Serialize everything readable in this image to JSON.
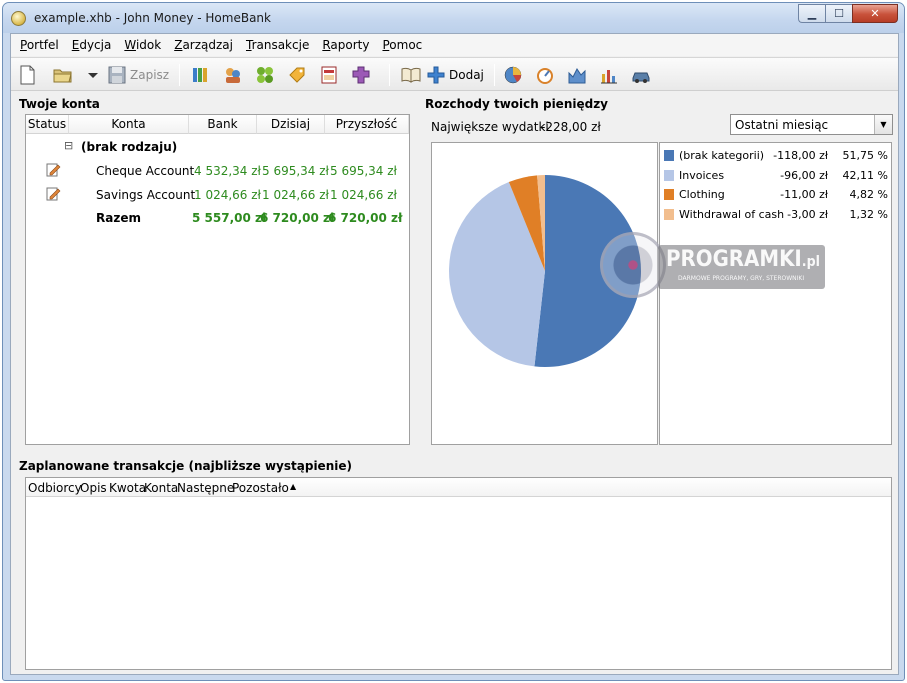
{
  "window": {
    "title": "example.xhb - John Money - HomeBank",
    "min_glyph": "▁",
    "max_glyph": "☐",
    "close_glyph": "✕"
  },
  "menu": [
    {
      "label": "Portfel",
      "ul": "P",
      "rest": "ortfel"
    },
    {
      "label": "Edycja",
      "ul": "E",
      "rest": "dycja"
    },
    {
      "label": "Widok",
      "ul": "W",
      "rest": "idok"
    },
    {
      "label": "Zarządzaj",
      "ul": "Z",
      "rest": "arządzaj"
    },
    {
      "label": "Transakcje",
      "ul": "T",
      "rest": "ransakcje"
    },
    {
      "label": "Raporty",
      "ul": "R",
      "rest": "aporty"
    },
    {
      "label": "Pomoc",
      "ul": "P",
      "rest": "omoc"
    }
  ],
  "toolbar": {
    "save_label": "Zapisz",
    "add_label": "Dodaj",
    "icons": [
      "new-file-icon",
      "open-folder-icon",
      "dropdown-arrow-icon",
      "save-disk-icon",
      "accounts-icon",
      "payees-icon",
      "categories-icon",
      "tags-icon",
      "archive-icon",
      "budget-icon",
      "book-icon",
      "add-icon",
      "stats-pie-icon",
      "budget-gauge-icon",
      "balance-chart-icon",
      "trend-chart-icon",
      "car-icon"
    ]
  },
  "accounts": {
    "section_title": "Twoje konta",
    "columns": [
      "Status",
      "Konta",
      "Bank",
      "Dzisiaj",
      "Przyszłość"
    ],
    "group": {
      "expander": "⊟",
      "label": "(brak rodzaju)"
    },
    "rows": [
      {
        "name": "Cheque Account",
        "bank": "4 532,34 zł",
        "today": "5 695,34 zł",
        "future": "5 695,34 zł"
      },
      {
        "name": "Savings Account",
        "bank": "1 024,66 zł",
        "today": "1 024,66 zł",
        "future": "1 024,66 zł"
      }
    ],
    "total": {
      "name": "Razem",
      "bank": "5 557,00 zł",
      "today": "6 720,00 zł",
      "future": "6 720,00 zł"
    }
  },
  "expenses": {
    "section_title": "Rozchody twoich pieniędzy",
    "biggest_label": "Największe wydatki",
    "biggest_value": "-228,00 zł",
    "period": "Ostatni miesiąc",
    "period_arrow": "▼"
  },
  "chart_data": {
    "type": "pie",
    "categories": [
      "(brak kategorii)",
      "Invoices",
      "Clothing",
      "Withdrawal of cash"
    ],
    "values": [
      -118.0,
      -96.0,
      -11.0,
      -3.0
    ],
    "value_labels": [
      "-118,00 zł",
      "-96,00 zł",
      "-11,00 zł",
      "-3,00 zł"
    ],
    "percents": [
      51.75,
      42.11,
      4.82,
      1.32
    ],
    "percent_labels": [
      "51,75 %",
      "42,11 %",
      "4,82 %",
      "1,32 %"
    ],
    "colors": [
      "#4a78b5",
      "#b5c6e6",
      "#e07f26",
      "#f2be8e"
    ],
    "legend": "right"
  },
  "scheduled": {
    "section_title": "Zaplanowane transakcje (najbliższe wystąpienie)",
    "columns": [
      "Odbiorcy",
      "Opis",
      "Kwota",
      "Konta",
      "Następne",
      "Pozostało"
    ],
    "sort_arrow": "▲"
  },
  "watermark": {
    "main": "PROGRAMKI",
    "suffix": ".pl",
    "sub": "DARMOWE PROGRAMY, GRY, STEROWNIKI"
  }
}
